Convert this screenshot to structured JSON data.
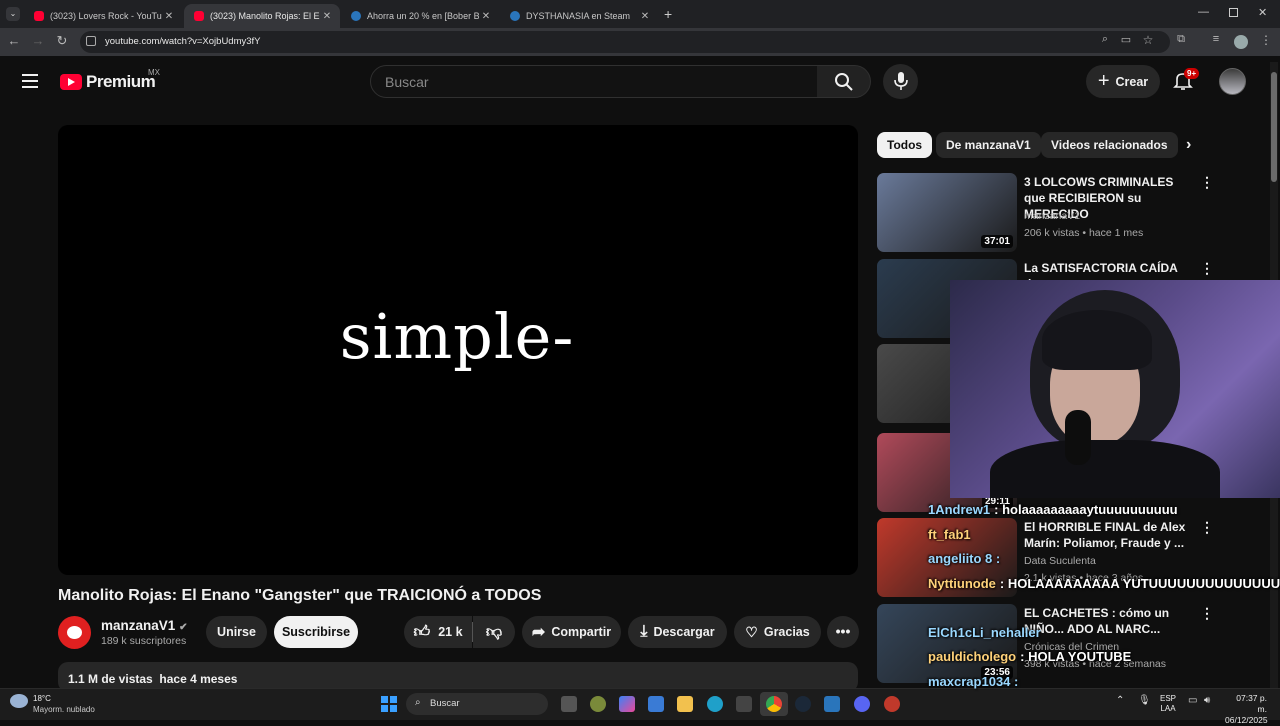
{
  "browser": {
    "tabs": [
      {
        "title": "(3023) Lovers Rock - YouTube",
        "icon": "youtube-icon"
      },
      {
        "title": "(3023) Manolito Rojas: El Enano",
        "icon": "youtube-icon"
      },
      {
        "title": "Ahorra un 20 % en [Bober Bros]",
        "icon": "steam-icon"
      },
      {
        "title": "DYSTHANASIA en Steam",
        "icon": "steam-icon"
      }
    ],
    "url": "youtube.com/watch?v=XojbUdmy3fY"
  },
  "header": {
    "logo": "Premium",
    "region": "MX",
    "search_placeholder": "Buscar",
    "create_label": "Crear",
    "notif_badge": "9+"
  },
  "player": {
    "text": "simple-"
  },
  "chips": [
    "Todos",
    "De manzanaV1",
    "Videos relacionados"
  ],
  "related": [
    {
      "title": "3 LOLCOWS CRIMINALES que RECIBIERON su MERECIDO",
      "channel": "manzanaV1",
      "meta": "206 k vistas • hace 1 mes",
      "duration": "37:01",
      "thumb_color": "#6a7a9a"
    },
    {
      "title": "La SATISFACTORIA CAÍDA de",
      "channel": "",
      "meta": "",
      "duration": "",
      "thumb_color": "#2b3c4f"
    },
    {
      "title": "",
      "channel": "",
      "meta": "",
      "duration": "",
      "thumb_color": "#4a4a4a"
    },
    {
      "title": "",
      "channel": "",
      "meta": "",
      "duration": "29:11",
      "thumb_color": "#b04a5a"
    },
    {
      "title": "El HORRIBLE FINAL de Alex Marín: Poliamor, Fraude y ...",
      "channel": "Data Suculenta",
      "meta": "2.1 k vistas • hace 3 años",
      "duration": "",
      "thumb_color": "#c0392b"
    },
    {
      "title": "EL CACHETES : cómo un NIÑO... ADO AL NARC...",
      "channel": "Crónicas del Crimen",
      "meta": "398 k vistas • hace 2 semanas",
      "duration": "23:56",
      "thumb_color": "#35465a"
    }
  ],
  "chat": [
    {
      "user": "1Andrew1",
      "msg": ": holaaaaaaaaaytuuuuuuuuuu"
    },
    {
      "user": "ft_fab1",
      "msg": ""
    },
    {
      "user": "angeliito 8 :",
      "msg": ""
    },
    {
      "user": "Nyttiunode",
      "msg": ": HOLAAAAAAAAA YUTUUUUUUUUUUUUUUUU"
    },
    {
      "user": "ElCh1cLi_nehaller",
      "msg": ""
    },
    {
      "user": "pauldicholego",
      "msg": ": HOLA YOUTUBE"
    },
    {
      "user": "maxcrap1034 :",
      "msg": ""
    }
  ],
  "video": {
    "title": "Manolito Rojas: El Enano \"Gangster\" que TRAICIONÓ a TODOS",
    "channel": "manzanaV1",
    "subscribers": "189 k suscriptores",
    "join_label": "Unirse",
    "subscribe_label": "Suscribirse",
    "likes": "21 k",
    "share_label": "Compartir",
    "download_label": "Descargar",
    "thanks_label": "Gracias",
    "views": "1.1 M de vistas",
    "date": "hace 4 meses"
  },
  "taskbar": {
    "temp": "18°C",
    "weather": "Mayorm. nublado",
    "search": "Buscar",
    "lang1": "ESP",
    "lang2": "LAA",
    "time": "07:37 p. m.",
    "date": "06/12/2025"
  }
}
